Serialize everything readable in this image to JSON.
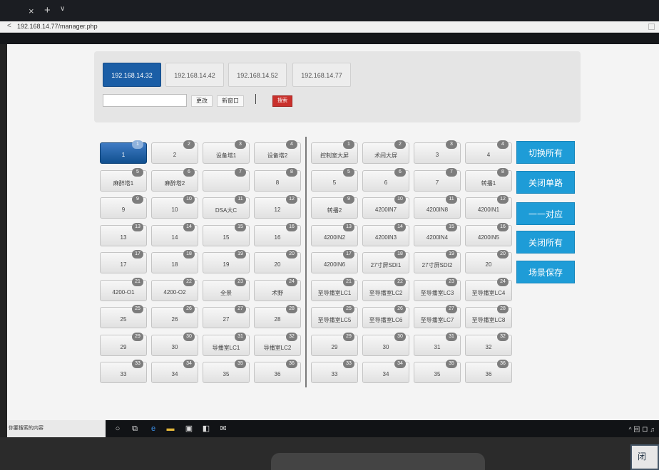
{
  "browser": {
    "url": "192.168.14.77/manager.php",
    "close_glyph": "×",
    "new_tab_glyph": "+",
    "tab_menu_glyph": "∨",
    "back_glyph": "<"
  },
  "hosts": {
    "tabs": [
      "192.168.14.32",
      "192.168.14.42",
      "192.168.14.52",
      "192.168.14.77"
    ],
    "active_index": 0,
    "input_value": "",
    "modify_label": "更改",
    "new_window_label": "新窗口",
    "search_label": "搜索"
  },
  "left_grid": {
    "cells": [
      {
        "badge": "1",
        "label": "1"
      },
      {
        "badge": "2",
        "label": "2"
      },
      {
        "badge": "3",
        "label": "设备塔1"
      },
      {
        "badge": "4",
        "label": "设备塔2"
      },
      {
        "badge": "5",
        "label": "麻醉塔1"
      },
      {
        "badge": "6",
        "label": "麻醉塔2"
      },
      {
        "badge": "7",
        "label": ""
      },
      {
        "badge": "8",
        "label": "8"
      },
      {
        "badge": "9",
        "label": "9"
      },
      {
        "badge": "10",
        "label": "10"
      },
      {
        "badge": "11",
        "label": "DSA大C"
      },
      {
        "badge": "12",
        "label": "12"
      },
      {
        "badge": "13",
        "label": "13"
      },
      {
        "badge": "14",
        "label": "14"
      },
      {
        "badge": "15",
        "label": "15"
      },
      {
        "badge": "16",
        "label": "16"
      },
      {
        "badge": "17",
        "label": "17"
      },
      {
        "badge": "18",
        "label": "18"
      },
      {
        "badge": "19",
        "label": "19"
      },
      {
        "badge": "20",
        "label": "20"
      },
      {
        "badge": "21",
        "label": "4200-O1"
      },
      {
        "badge": "22",
        "label": "4200-O2"
      },
      {
        "badge": "23",
        "label": "全景"
      },
      {
        "badge": "24",
        "label": "术野"
      },
      {
        "badge": "25",
        "label": "25"
      },
      {
        "badge": "26",
        "label": "26"
      },
      {
        "badge": "27",
        "label": "27"
      },
      {
        "badge": "28",
        "label": "28"
      },
      {
        "badge": "29",
        "label": "29"
      },
      {
        "badge": "30",
        "label": "30"
      },
      {
        "badge": "31",
        "label": "导播室LC1"
      },
      {
        "badge": "32",
        "label": "导播室LC2"
      },
      {
        "badge": "33",
        "label": "33"
      },
      {
        "badge": "34",
        "label": "34"
      },
      {
        "badge": "35",
        "label": "35"
      },
      {
        "badge": "36",
        "label": "36"
      }
    ],
    "active_index": 0
  },
  "right_grid": {
    "cells": [
      {
        "badge": "1",
        "label": "控制室大屏"
      },
      {
        "badge": "2",
        "label": "术间大屏"
      },
      {
        "badge": "3",
        "label": "3"
      },
      {
        "badge": "4",
        "label": "4"
      },
      {
        "badge": "5",
        "label": "5"
      },
      {
        "badge": "6",
        "label": "6"
      },
      {
        "badge": "7",
        "label": "7"
      },
      {
        "badge": "8",
        "label": "转播1"
      },
      {
        "badge": "9",
        "label": "转播2"
      },
      {
        "badge": "10",
        "label": "4200IN7"
      },
      {
        "badge": "11",
        "label": "4200IN8"
      },
      {
        "badge": "12",
        "label": "4200IN1"
      },
      {
        "badge": "13",
        "label": "4200IN2"
      },
      {
        "badge": "14",
        "label": "4200IN3"
      },
      {
        "badge": "15",
        "label": "4200IN4"
      },
      {
        "badge": "16",
        "label": "4200IN5"
      },
      {
        "badge": "17",
        "label": "4200IN6"
      },
      {
        "badge": "18",
        "label": "27寸屏SDI1"
      },
      {
        "badge": "19",
        "label": "27寸屏SDI2"
      },
      {
        "badge": "20",
        "label": "20"
      },
      {
        "badge": "21",
        "label": "至导播室LC1"
      },
      {
        "badge": "22",
        "label": "至导播室LC2"
      },
      {
        "badge": "23",
        "label": "至导播室LC3"
      },
      {
        "badge": "24",
        "label": "至导播室LC4"
      },
      {
        "badge": "25",
        "label": "至导播室LC5"
      },
      {
        "badge": "26",
        "label": "至导播室LC6"
      },
      {
        "badge": "27",
        "label": "至导播室LC7"
      },
      {
        "badge": "28",
        "label": "至导播室LC8"
      },
      {
        "badge": "29",
        "label": "29"
      },
      {
        "badge": "30",
        "label": "30"
      },
      {
        "badge": "31",
        "label": "31"
      },
      {
        "badge": "32",
        "label": "32"
      },
      {
        "badge": "33",
        "label": "33"
      },
      {
        "badge": "34",
        "label": "34"
      },
      {
        "badge": "35",
        "label": "35"
      },
      {
        "badge": "36",
        "label": "36"
      }
    ]
  },
  "actions": [
    "切换所有",
    "关闭单路",
    "一一对应",
    "关闭所有",
    "场景保存"
  ],
  "taskbar": {
    "search_text": "你要搜索的内容",
    "icons": [
      "cortana-circle-icon",
      "task-view-icon",
      "edge-icon",
      "file-explorer-icon",
      "store-icon",
      "app-icon",
      "mail-icon"
    ],
    "tray_text": "^ 回 ロ ♫"
  },
  "colors": {
    "active_tab": "#1b5ea6",
    "action_button": "#1e9cd7",
    "search_button": "#c9302c"
  }
}
